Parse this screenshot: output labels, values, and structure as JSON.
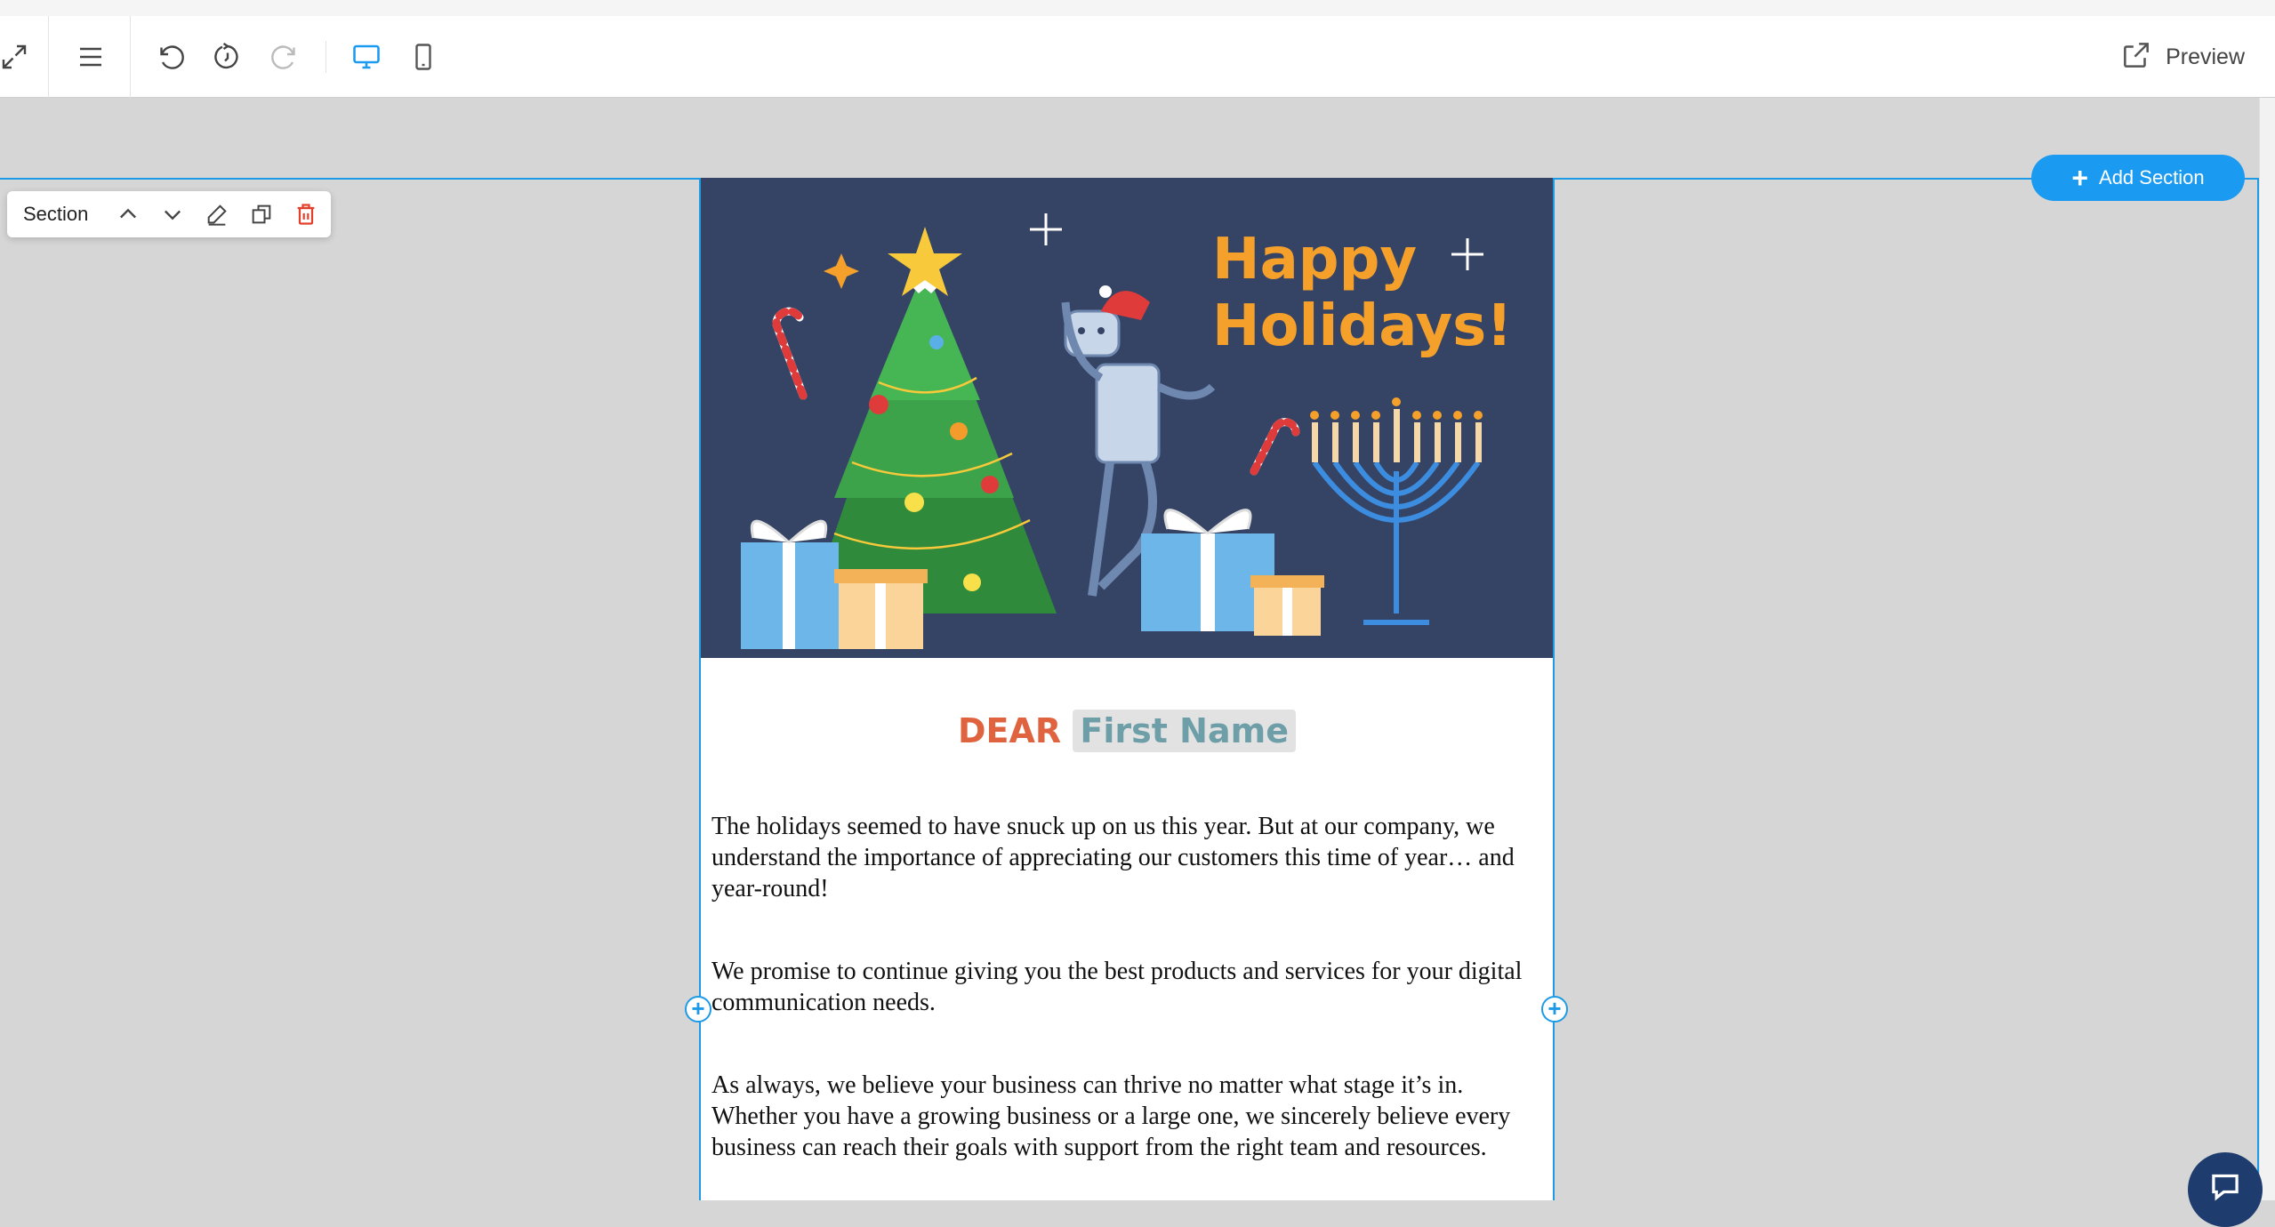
{
  "toolbar": {
    "icons": [
      "expand-icon",
      "menu-icon",
      "undo-icon",
      "history-icon",
      "redo-icon",
      "desktop-icon",
      "mobile-icon"
    ],
    "preview_label": "Preview",
    "active_color": "#1a9af0"
  },
  "canvas": {
    "add_section_label": "Add Section",
    "section_toolbar": {
      "label": "Section",
      "icons": [
        "chevron-up-icon",
        "chevron-down-icon",
        "edit-icon",
        "duplicate-icon",
        "delete-icon"
      ]
    },
    "accent_color": "#1e9be6"
  },
  "email": {
    "hero": {
      "line1": "Happy",
      "line2": "Holidays!",
      "background": "#354465",
      "text_color": "#f5a02a"
    },
    "greeting": {
      "dear": "DEAR",
      "name_token": "First Name"
    },
    "paragraphs": [
      "The holidays seemed to have snuck up on us this year. But at our company, we understand the importance of appreciating our customers this time of year… and year-round!",
      "We promise to continue giving you the best products and services for your digital communication needs.",
      "As always, we believe your business can thrive no matter what stage it’s in. Whether you have a growing business or a large one, we sincerely believe every business can reach their goals with support from the right team and resources."
    ]
  },
  "support": {
    "icon": "chat-icon"
  }
}
